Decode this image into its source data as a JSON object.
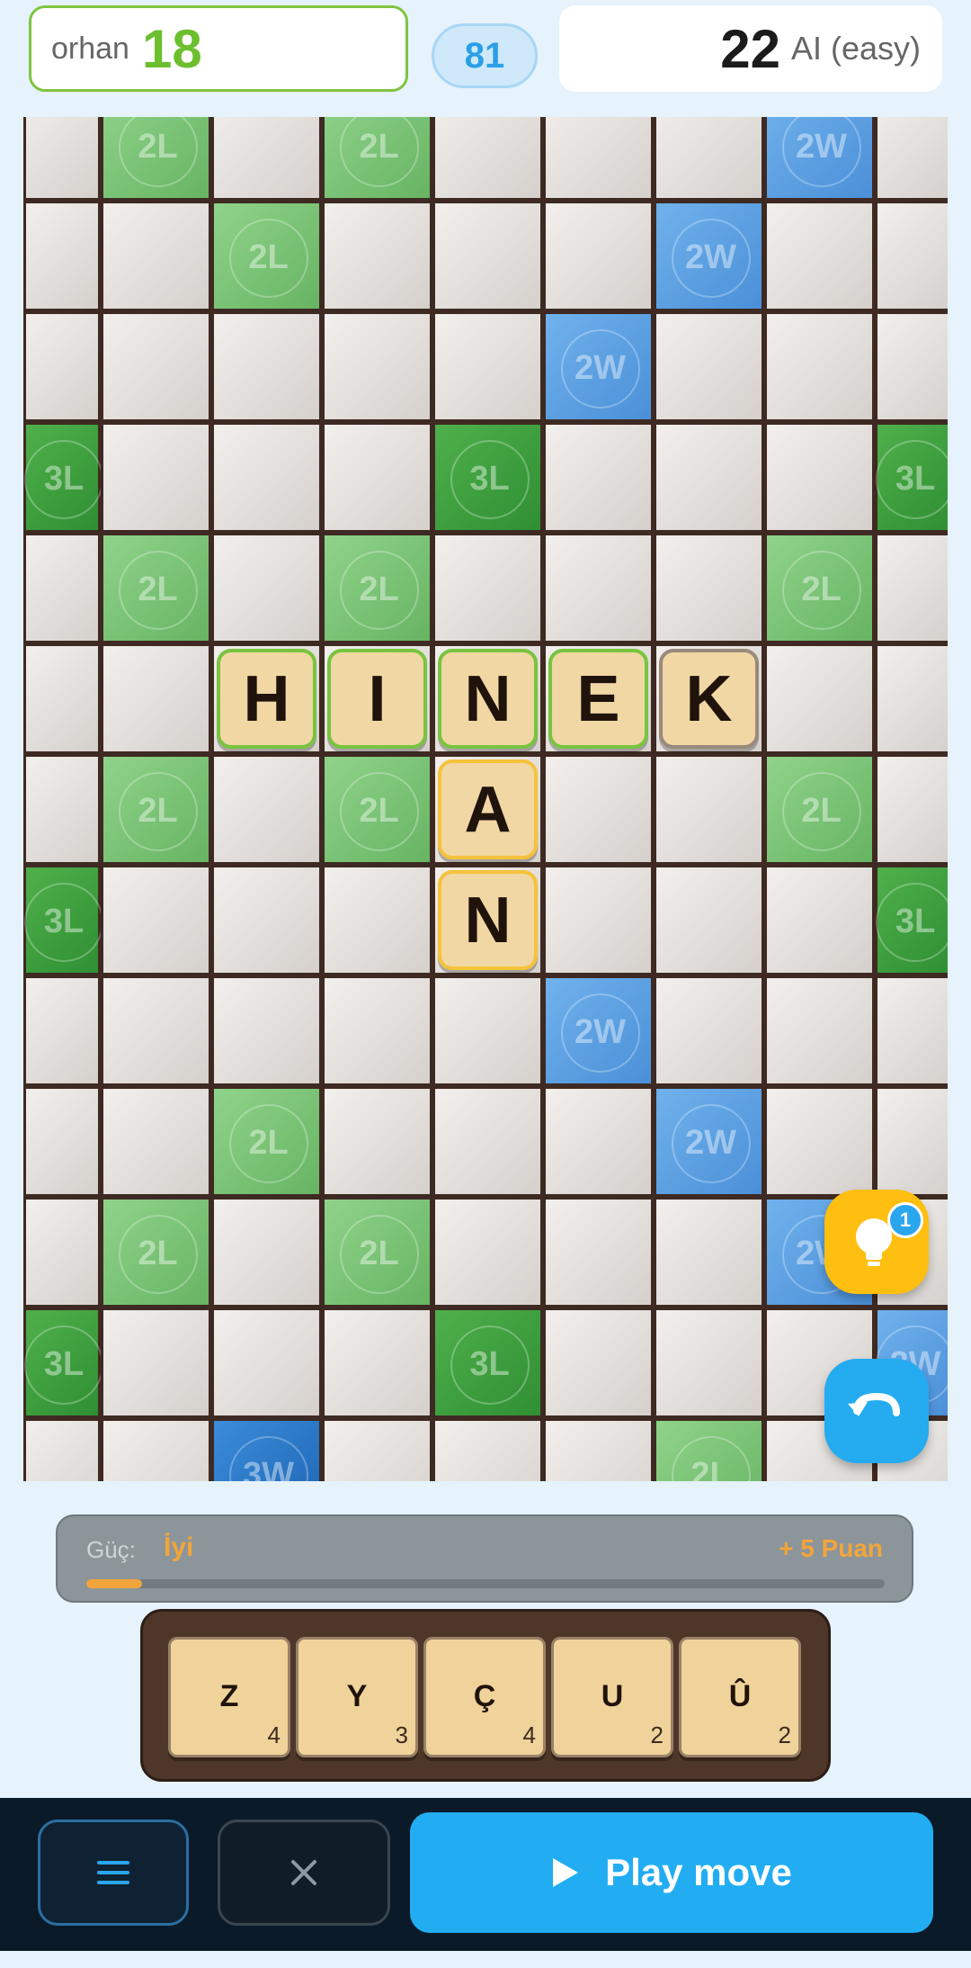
{
  "header": {
    "player_name": "orhan",
    "player_score": "18",
    "tiles_left": "81",
    "opponent_score": "22",
    "opponent_name": "AI (easy)"
  },
  "board": {
    "cols": 9,
    "visible_rows": 13,
    "bonuses": [
      {
        "r": 0,
        "c": 1,
        "label": "2L"
      },
      {
        "r": 0,
        "c": 3,
        "label": "2L"
      },
      {
        "r": 0,
        "c": 7,
        "label": "2W"
      },
      {
        "r": 1,
        "c": 2,
        "label": "2L"
      },
      {
        "r": 1,
        "c": 6,
        "label": "2W"
      },
      {
        "r": 2,
        "c": 5,
        "label": "2W"
      },
      {
        "r": 3,
        "c": 0,
        "label": "3L"
      },
      {
        "r": 3,
        "c": 4,
        "label": "3L"
      },
      {
        "r": 3,
        "c": 8,
        "label": "3L"
      },
      {
        "r": 4,
        "c": 1,
        "label": "2L"
      },
      {
        "r": 4,
        "c": 3,
        "label": "2L"
      },
      {
        "r": 4,
        "c": 7,
        "label": "2L"
      },
      {
        "r": 6,
        "c": 1,
        "label": "2L"
      },
      {
        "r": 6,
        "c": 3,
        "label": "2L"
      },
      {
        "r": 6,
        "c": 7,
        "label": "2L"
      },
      {
        "r": 7,
        "c": 0,
        "label": "3L"
      },
      {
        "r": 7,
        "c": 8,
        "label": "3L"
      },
      {
        "r": 8,
        "c": 5,
        "label": "2W"
      },
      {
        "r": 9,
        "c": 2,
        "label": "2L"
      },
      {
        "r": 9,
        "c": 6,
        "label": "2W"
      },
      {
        "r": 10,
        "c": 1,
        "label": "2L"
      },
      {
        "r": 10,
        "c": 3,
        "label": "2L"
      },
      {
        "r": 10,
        "c": 7,
        "label": "2W"
      },
      {
        "r": 11,
        "c": 0,
        "label": "3L"
      },
      {
        "r": 11,
        "c": 4,
        "label": "3L"
      },
      {
        "r": 11,
        "c": 8,
        "label": "2W"
      },
      {
        "r": 12,
        "c": 2,
        "label": "3W"
      },
      {
        "r": 12,
        "c": 6,
        "label": "2L"
      }
    ],
    "tiles": [
      {
        "r": 5,
        "c": 2,
        "letter": "H",
        "state": "word"
      },
      {
        "r": 5,
        "c": 3,
        "letter": "I",
        "state": "word"
      },
      {
        "r": 5,
        "c": 4,
        "letter": "N",
        "state": "word"
      },
      {
        "r": 5,
        "c": 5,
        "letter": "E",
        "state": "word"
      },
      {
        "r": 5,
        "c": 6,
        "letter": "K",
        "state": "fixed"
      },
      {
        "r": 6,
        "c": 4,
        "letter": "A",
        "state": "placed"
      },
      {
        "r": 7,
        "c": 4,
        "letter": "N",
        "state": "placed"
      }
    ]
  },
  "hint": {
    "badge": "1"
  },
  "power": {
    "label": "Güç:",
    "value": "İyi",
    "points": "+ 5 Puan",
    "fill_fraction": 0.07
  },
  "rack": [
    {
      "letter": "Z",
      "value": "4"
    },
    {
      "letter": "Y",
      "value": "3"
    },
    {
      "letter": "Ç",
      "value": "4"
    },
    {
      "letter": "U",
      "value": "2"
    },
    {
      "letter": "Û",
      "value": "2"
    }
  ],
  "actions": {
    "play_label": "Play move"
  },
  "colors": {
    "accent": "#22adf3",
    "player": "#6dbf2e",
    "tile": "#f1d7a4"
  },
  "icons": {
    "menu": "hamburger-icon",
    "cancel": "close-icon",
    "play": "play-icon",
    "hint": "lightbulb-icon",
    "undo": "undo-icon"
  }
}
